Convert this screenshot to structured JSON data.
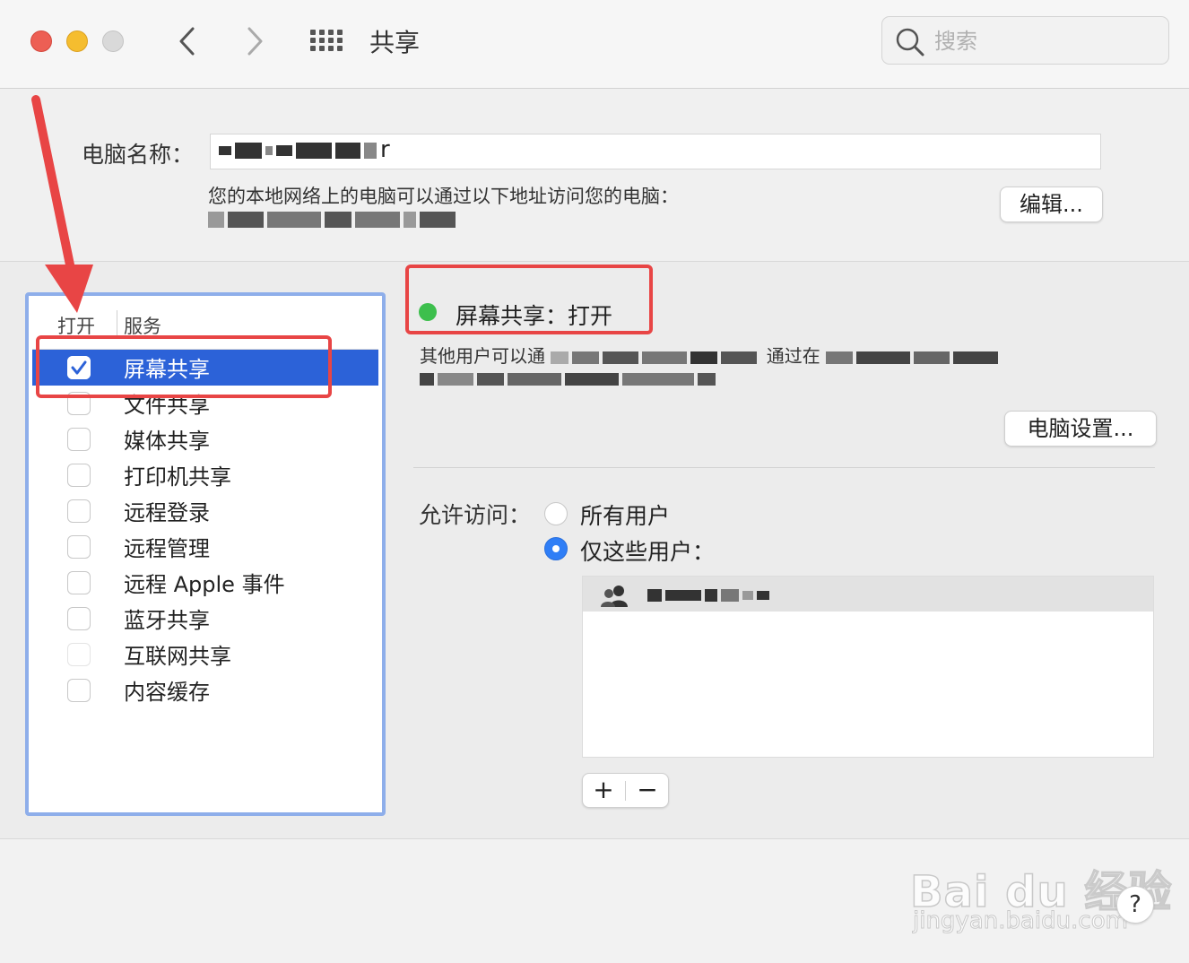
{
  "window": {
    "title": "共享",
    "search_placeholder": "搜索"
  },
  "computer": {
    "name_label": "电脑名称：",
    "name_value_visible": "r",
    "address_text": "您的本地网络上的电脑可以通过以下地址访问您的电脑：",
    "edit_button": "编辑..."
  },
  "services": {
    "header_open": "打开",
    "header_service": "服务",
    "items": [
      {
        "label": "屏幕共享",
        "checked": true,
        "selected": true
      },
      {
        "label": "文件共享",
        "checked": false,
        "selected": false
      },
      {
        "label": "媒体共享",
        "checked": false,
        "selected": false
      },
      {
        "label": "打印机共享",
        "checked": false,
        "selected": false
      },
      {
        "label": "远程登录",
        "checked": false,
        "selected": false
      },
      {
        "label": "远程管理",
        "checked": false,
        "selected": false
      },
      {
        "label": "远程 Apple 事件",
        "checked": false,
        "selected": false
      },
      {
        "label": "蓝牙共享",
        "checked": false,
        "selected": false
      },
      {
        "label": "互联网共享",
        "checked": false,
        "selected": false,
        "disabled": true
      },
      {
        "label": "内容缓存",
        "checked": false,
        "selected": false
      }
    ]
  },
  "detail": {
    "status_label": "屏幕共享：打开",
    "status_color": "#3dbf4d",
    "description_start": "其他用户可以通",
    "description_mid": "通过在",
    "settings_button": "电脑设置...",
    "access_label": "允许访问：",
    "access_options": [
      {
        "label": "所有用户",
        "selected": false
      },
      {
        "label": "仅这些用户：",
        "selected": true
      }
    ],
    "add_button": "+",
    "remove_button": "−"
  },
  "help": "?",
  "watermark": {
    "main": "Bai du 经验",
    "sub": "jingyan.baidu.com"
  },
  "annotations": {
    "highlight_color": "#e84545",
    "list_border_color": "#8eaeea",
    "selection_color": "#2c62d8",
    "radio_color": "#2f7ef6"
  }
}
